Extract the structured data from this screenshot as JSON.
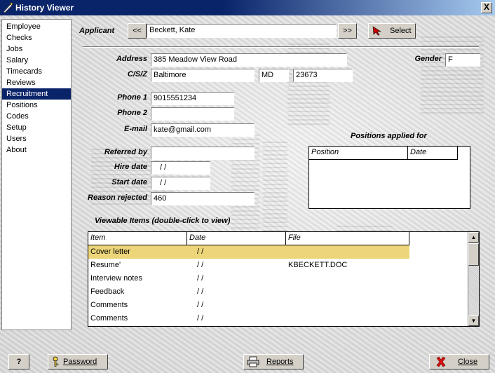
{
  "window": {
    "title": "History Viewer",
    "close_glyph": "X"
  },
  "sidebar": {
    "items": [
      {
        "label": "Employee"
      },
      {
        "label": "Checks"
      },
      {
        "label": "Jobs"
      },
      {
        "label": "Salary"
      },
      {
        "label": "Timecards"
      },
      {
        "label": "Reviews"
      },
      {
        "label": "Recruitment",
        "selected": true
      },
      {
        "label": "Positions"
      },
      {
        "label": "Codes"
      },
      {
        "label": "Setup"
      },
      {
        "label": "Users"
      },
      {
        "label": "About"
      }
    ]
  },
  "applicant": {
    "label": "Applicant",
    "prev_label": "<<",
    "next_label": ">>",
    "value": "Beckett, Kate",
    "select_label": "Select"
  },
  "form": {
    "address_label": "Address",
    "address": "385 Meadow View Road",
    "gender_label": "Gender",
    "gender": "F",
    "csz_label": "C/S/Z",
    "city": "Baltimore",
    "state": "MD",
    "zip": "23673",
    "phone1_label": "Phone 1",
    "phone1": "9015551234",
    "phone2_label": "Phone 2",
    "phone2": "",
    "email_label": "E-mail",
    "email": "kate@gmail.com",
    "referred_label": "Referred by",
    "referred": "",
    "hire_label": "Hire date",
    "hire": "  /   /",
    "start_label": "Start date",
    "start": "  /   /",
    "reason_label": "Reason rejected",
    "reason": "460"
  },
  "positions": {
    "title": "Positions applied for",
    "columns": [
      "Position",
      "Date"
    ]
  },
  "viewable": {
    "title": "Viewable Items (double-click to view)",
    "columns": [
      "Item",
      "Date",
      "File"
    ],
    "rows": [
      {
        "item": "Cover letter",
        "date": "/   /",
        "file": "",
        "selected": true
      },
      {
        "item": "Resume'",
        "date": "/   /",
        "file": "KBECKETT.DOC"
      },
      {
        "item": "Interview notes",
        "date": "/   /",
        "file": ""
      },
      {
        "item": "Feedback",
        "date": "/   /",
        "file": ""
      },
      {
        "item": "Comments",
        "date": "/   /",
        "file": ""
      },
      {
        "item": "Comments",
        "date": "/   /",
        "file": ""
      }
    ]
  },
  "footer": {
    "help_label": "?",
    "password_label": "Password",
    "reports_label": "Reports",
    "close_label": "Close"
  },
  "icons": {
    "app": "quill-icon",
    "select": "pointer-icon",
    "password": "key-icon",
    "reports": "printer-icon",
    "close": "red-x-icon"
  },
  "colors": {
    "titlebar": "#0a246a",
    "selected_row": "#ecd679",
    "sidebar_selected": "#0a246a"
  }
}
